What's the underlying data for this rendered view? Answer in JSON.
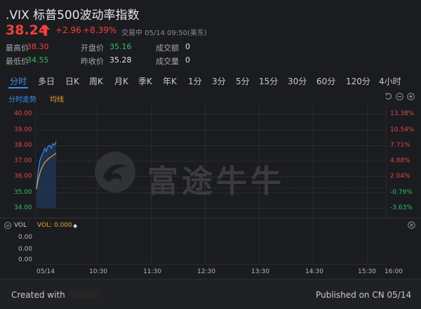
{
  "header": {
    "title": ".VIX 标普500波动率指数",
    "price": "38.24",
    "change": "+2.96",
    "change_pct": "+8.39%",
    "status": "交易中 05/14 09:50(美东)"
  },
  "stats": [
    {
      "label": "最高价",
      "value": "38.30",
      "color": "#f0403c"
    },
    {
      "label": "开盘价",
      "value": "35.16",
      "color": "#2fbf5d"
    },
    {
      "label": "成交额",
      "value": "0",
      "color": "#e0e1e4"
    },
    {
      "label": "最低价",
      "value": "34.55",
      "color": "#2fbf5d"
    },
    {
      "label": "昨收价",
      "value": "35.28",
      "color": "#e0e1e4"
    },
    {
      "label": "成交量",
      "value": "0",
      "color": "#e0e1e4"
    }
  ],
  "tabs": [
    "分时",
    "多日",
    "日K",
    "周K",
    "月K",
    "季K",
    "年K",
    "1分",
    "3分",
    "5分",
    "15分",
    "30分",
    "60分",
    "120分",
    "4小时"
  ],
  "active_tab": "分时",
  "chart_legend": {
    "line": "分时走势",
    "avg": "均线"
  },
  "price_axis": [
    "40.00",
    "39.00",
    "38.00",
    "37.00",
    "36.00",
    "35.00",
    "34.00"
  ],
  "pct_axis": [
    "13.38%",
    "10.54%",
    "7.71%",
    "4.88%",
    "2.04%",
    "-0.79%",
    "-3.63%"
  ],
  "watermark": "富途牛牛",
  "volume": {
    "label": "VOL",
    "value_text": "VOL: 0.000",
    "axis": [
      "0.00",
      "0.00",
      "0.00"
    ]
  },
  "time_axis": [
    "05/14",
    "10:30",
    "11:30",
    "12:30",
    "13:30",
    "14:30",
    "15:30",
    "16:00"
  ],
  "footer": {
    "created": "Created with",
    "published": "Published on CN 05/14"
  },
  "colors": {
    "up": "#f0403c",
    "down": "#2fbf5d",
    "accent": "#3b8ef0",
    "avg_line": "#e8a33a",
    "background": "#1b1c20"
  },
  "chart_data": {
    "type": "line",
    "title": "",
    "xlabel": "",
    "ylabel": "",
    "x": [
      "09:30",
      "09:31",
      "09:32",
      "09:33",
      "09:34",
      "09:36",
      "09:38",
      "09:40",
      "09:42",
      "09:44",
      "09:46",
      "09:48",
      "09:50"
    ],
    "series": [
      {
        "values": [
          35.2,
          36.3,
          37.0,
          37.3,
          37.5,
          37.8,
          37.6,
          37.9,
          38.0,
          37.8,
          38.1,
          38.0,
          38.24
        ]
      },
      {
        "values": [
          35.2,
          35.8,
          36.2,
          36.5,
          36.7,
          36.9,
          37.0,
          37.1,
          37.2,
          37.25,
          37.35,
          37.4,
          37.5
        ]
      }
    ],
    "ylim": [
      34.0,
      40.0
    ]
  }
}
